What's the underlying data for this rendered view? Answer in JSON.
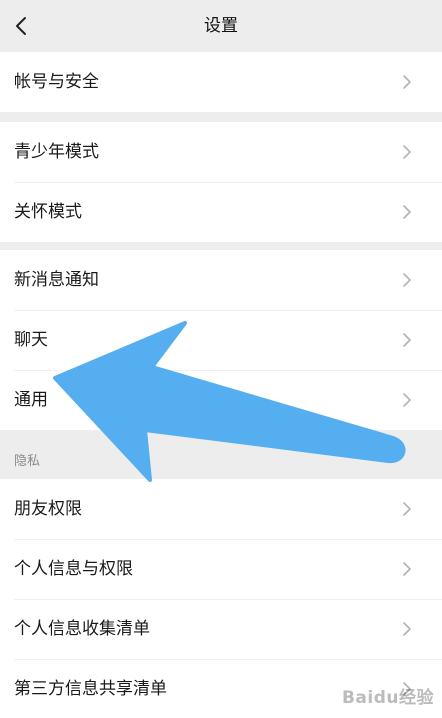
{
  "nav": {
    "title": "设置",
    "back_icon": "chevron-left-icon"
  },
  "groups": [
    {
      "items": [
        {
          "label": "帐号与安全"
        }
      ]
    },
    {
      "items": [
        {
          "label": "青少年模式"
        },
        {
          "label": "关怀模式"
        }
      ]
    },
    {
      "items": [
        {
          "label": "新消息通知"
        },
        {
          "label": "聊天"
        },
        {
          "label": "通用"
        }
      ]
    },
    {
      "section_title": "隐私",
      "items": [
        {
          "label": "朋友权限"
        },
        {
          "label": "个人信息与权限"
        },
        {
          "label": "个人信息收集清单"
        },
        {
          "label": "第三方信息共享清单"
        }
      ]
    }
  ],
  "colors": {
    "background": "#ededed",
    "row_background": "#ffffff",
    "annotation_arrow": "#55aef0",
    "badge": "#fa5151"
  },
  "watermark": "Baidu经验"
}
